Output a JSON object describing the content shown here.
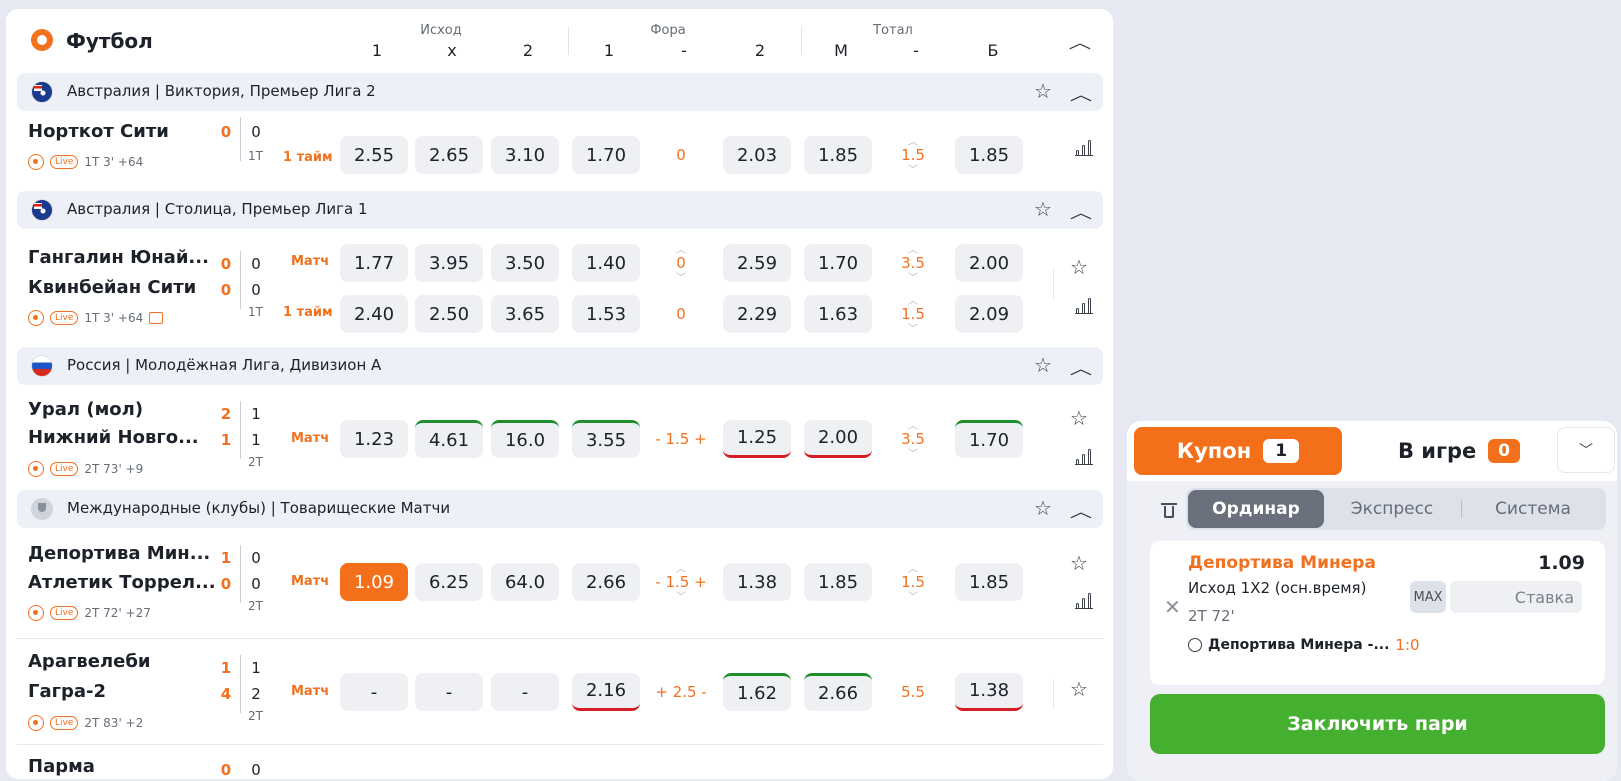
{
  "sport": {
    "title": "Футбол"
  },
  "columns": {
    "groups": [
      "Исход",
      "Фора",
      "Тотал"
    ],
    "cols": [
      "1",
      "x",
      "2",
      "1",
      "-",
      "2",
      "М",
      "-",
      "Б"
    ]
  },
  "leagues": [
    {
      "name": "Австралия | Виктория, Премьер Лига 2"
    },
    {
      "name": "Австралия | Столица, Премьер Лига 1"
    },
    {
      "name": "Россия | Молодёжная Лига, Дивизион А"
    },
    {
      "name": "Международные (клубы) | Товарищеские Матчи"
    }
  ],
  "matches": [
    {
      "teams": [
        "Норткот Сити"
      ],
      "score1": [
        "0"
      ],
      "score2": [
        "0"
      ],
      "period": "1Т",
      "meta": "1Т 3' +64",
      "rows": [
        {
          "label": "1 тайм",
          "odds": [
            "2.55",
            "2.65",
            "3.10",
            "1.70",
            "2.03",
            "1.85",
            "1.85"
          ],
          "handicap": "0",
          "total": "1.5"
        }
      ]
    },
    {
      "teams": [
        "Гангалин Юнай...",
        "Квинбейан Сити"
      ],
      "score1": [
        "0",
        "0"
      ],
      "score2": [
        "0",
        "0"
      ],
      "period": "1Т",
      "meta": "1Т 3' +64",
      "rows": [
        {
          "label": "Матч",
          "odds": [
            "1.77",
            "3.95",
            "3.50",
            "1.40",
            "2.59",
            "1.70",
            "2.00"
          ],
          "handicap": "0",
          "total": "3.5"
        },
        {
          "label": "1 тайм",
          "odds": [
            "2.40",
            "2.50",
            "3.65",
            "1.53",
            "2.29",
            "1.63",
            "2.09"
          ],
          "handicap": "0",
          "total": "1.5"
        }
      ]
    },
    {
      "teams": [
        "Урал (мол)",
        "Нижний Новго..."
      ],
      "score1": [
        "2",
        "1"
      ],
      "score2": [
        "1",
        "1"
      ],
      "period": "2Т",
      "meta": "2Т 73' +9",
      "rows": [
        {
          "label": "Матч",
          "odds": [
            "1.23",
            "4.61",
            "16.0",
            "3.55",
            "1.25",
            "2.00",
            "1.70"
          ],
          "handicap": "- 1.5 +",
          "total": "3.5"
        }
      ]
    },
    {
      "teams": [
        "Депортива Мин...",
        "Атлетик Торрел..."
      ],
      "score1": [
        "1",
        "0"
      ],
      "score2": [
        "0",
        "0"
      ],
      "period": "2Т",
      "meta": "2Т 72' +27",
      "rows": [
        {
          "label": "Матч",
          "odds": [
            "1.09",
            "6.25",
            "64.0",
            "2.66",
            "1.38",
            "1.85",
            "1.85"
          ],
          "handicap": "- 1.5 +",
          "total": "1.5"
        }
      ]
    },
    {
      "teams": [
        "Арагвелеби",
        "Гагра-2"
      ],
      "score1": [
        "1",
        "4"
      ],
      "score2": [
        "1",
        "2"
      ],
      "period": "2Т",
      "meta": "2Т 83' +2",
      "rows": [
        {
          "label": "Матч",
          "odds": [
            "-",
            "-",
            "-",
            "2.16",
            "1.62",
            "2.66",
            "1.38"
          ],
          "handicap": "+ 2.5 -",
          "total": "5.5"
        }
      ]
    },
    {
      "teams": [
        "Парма"
      ],
      "score1": [
        "0"
      ],
      "score2": [
        "0"
      ]
    }
  ],
  "coupon": {
    "tab_coupon": "Купон",
    "coupon_count": "1",
    "tab_ingame": "В игре",
    "ingame_count": "0",
    "modes": [
      "Ординар",
      "Экспресс",
      "Система"
    ],
    "bet": {
      "team": "Депортива Минера",
      "odd": "1.09",
      "market": "Исход 1Х2 (осн.время)",
      "time": "2Т 72'",
      "match": "Депортива Минера -...",
      "score": "1:0",
      "max": "MAX",
      "stake_placeholder": "Ставка"
    },
    "place_bet": "Заключить пари"
  },
  "icons": {
    "live": "Live"
  },
  "colors": {
    "accent": "#f46f1a",
    "green": "#45b02f",
    "up": "#1f8f2e",
    "down": "#d51f26"
  }
}
